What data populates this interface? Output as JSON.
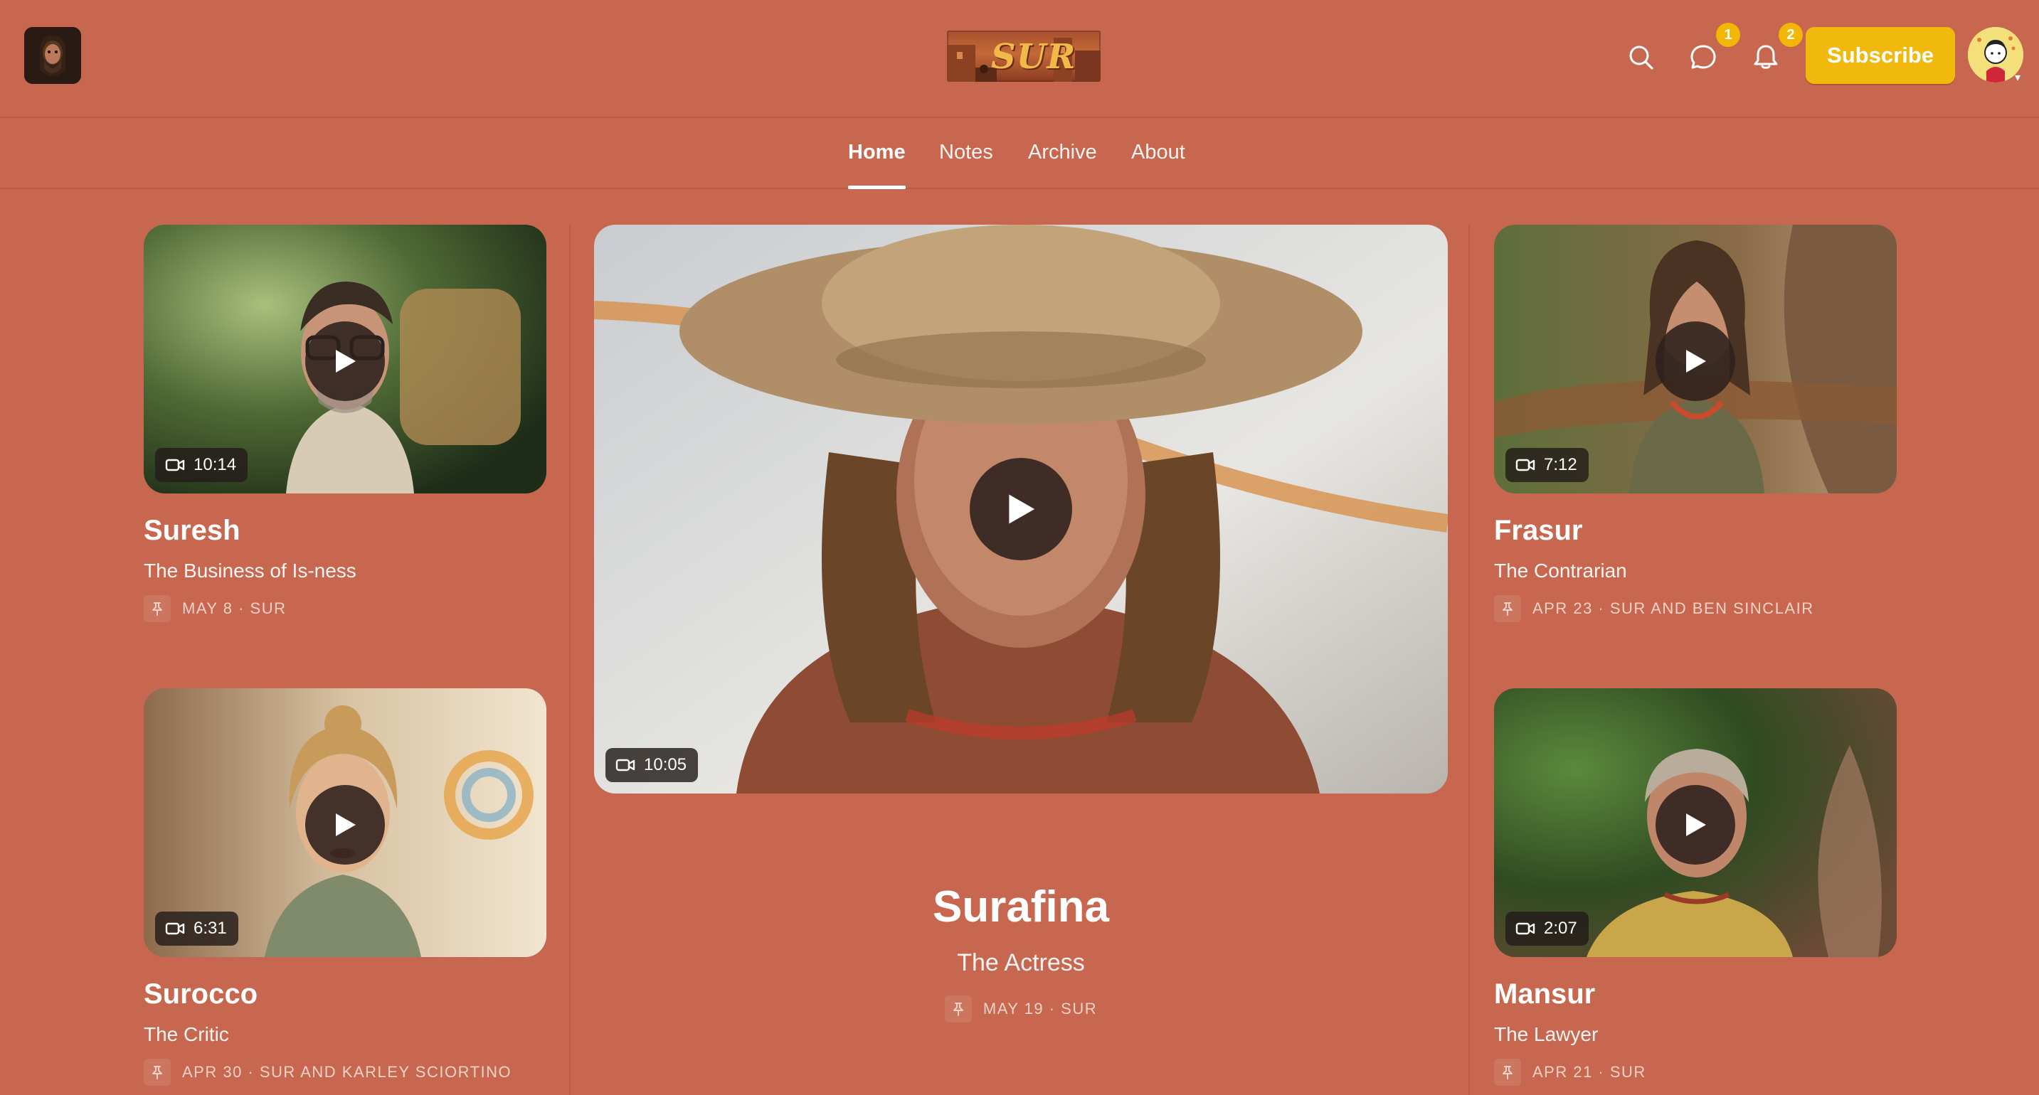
{
  "header": {
    "publication_name": "SUR",
    "subscribe_label": "Subscribe",
    "messages_badge": "1",
    "notifications_badge": "2",
    "icons": [
      "search-icon",
      "chat-icon",
      "bell-icon"
    ]
  },
  "nav": {
    "items": [
      {
        "label": "Home",
        "active": true
      },
      {
        "label": "Notes",
        "active": false
      },
      {
        "label": "Archive",
        "active": false
      },
      {
        "label": "About",
        "active": false
      }
    ]
  },
  "colors": {
    "background": "#c7674f",
    "accent": "#f0b90b",
    "text": "#ffffff"
  },
  "posts": {
    "suresh": {
      "title": "Suresh",
      "subtitle": "The Business of Is-ness",
      "meta": "MAY 8 · SUR",
      "duration": "10:14"
    },
    "surocco": {
      "title": "Surocco",
      "subtitle": "The Critic",
      "meta": "APR 30 · SUR AND KARLEY SCIORTINO",
      "duration": "6:31"
    },
    "surafina": {
      "title": "Surafina",
      "subtitle": "The Actress",
      "meta": "MAY 19 · SUR",
      "duration": "10:05"
    },
    "frasur": {
      "title": "Frasur",
      "subtitle": "The Contrarian",
      "meta": "APR 23 · SUR AND BEN SINCLAIR",
      "duration": "7:12"
    },
    "mansur": {
      "title": "Mansur",
      "subtitle": "The Lawyer",
      "meta": "APR 21 · SUR",
      "duration": "2:07"
    }
  }
}
